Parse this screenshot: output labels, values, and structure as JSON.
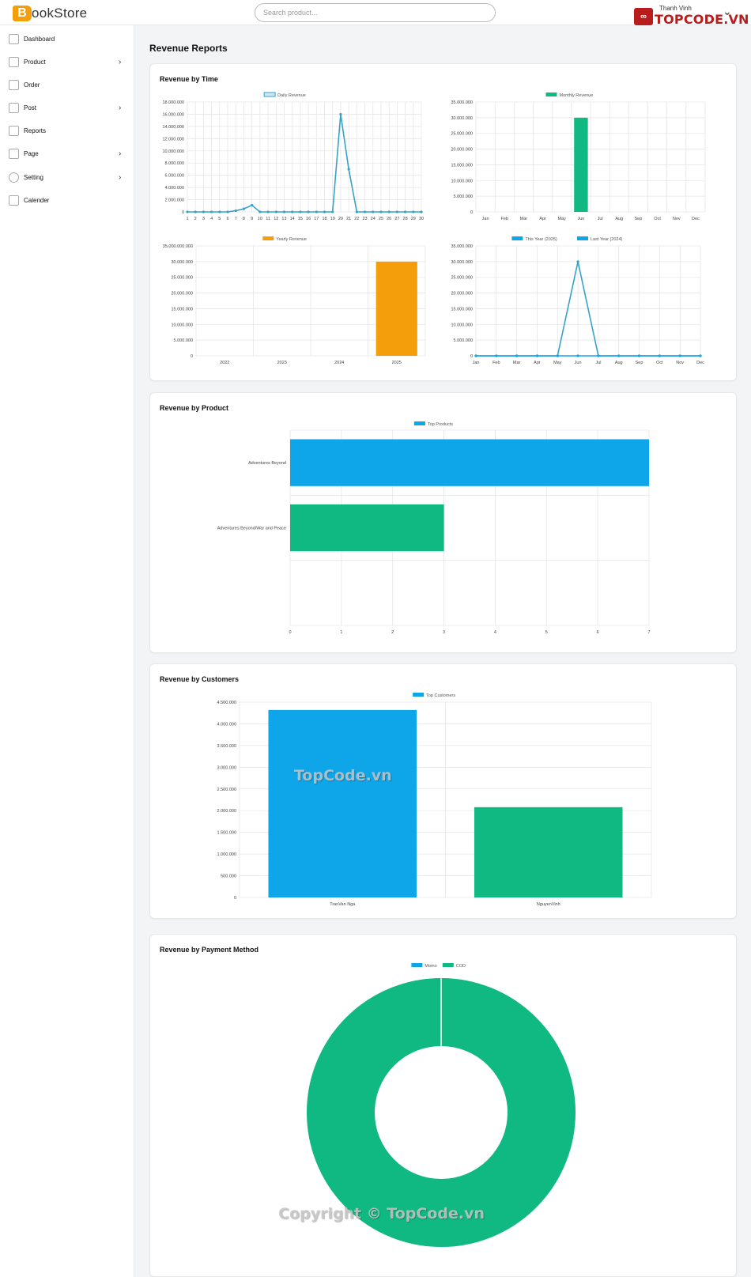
{
  "app": {
    "logo_letter": "B",
    "logo_text": "ookStore"
  },
  "search": {
    "placeholder": "Search product..."
  },
  "brand": {
    "user_name": "Thanh Vinh",
    "name": "TOPCODE.VN"
  },
  "sidebar": {
    "items": [
      {
        "label": "Dashboard",
        "icon": "home-icon",
        "has_submenu": false
      },
      {
        "label": "Product",
        "icon": "box-icon",
        "has_submenu": true
      },
      {
        "label": "Order",
        "icon": "clipboard-icon",
        "has_submenu": false
      },
      {
        "label": "Post",
        "icon": "note-icon",
        "has_submenu": true
      },
      {
        "label": "Reports",
        "icon": "chart-icon",
        "has_submenu": false
      },
      {
        "label": "Page",
        "icon": "page-icon",
        "has_submenu": true
      },
      {
        "label": "Setting",
        "icon": "gear-icon",
        "has_submenu": true
      },
      {
        "label": "Calender",
        "icon": "calendar-icon",
        "has_submenu": false
      }
    ]
  },
  "page": {
    "title": "Revenue Reports"
  },
  "sections": {
    "time": "Revenue by Time",
    "product": "Revenue by Product",
    "customers": "Revenue by Customers",
    "payment": "Revenue by Payment Method"
  },
  "colors": {
    "blue": "#0ea5e9",
    "line": "#36a2c8",
    "green": "#10b981",
    "orange": "#f59e0b"
  },
  "chart_data": [
    {
      "id": "daily",
      "type": "line",
      "legend": [
        "Daily Revenue"
      ],
      "x": [
        "1",
        "2",
        "3",
        "4",
        "5",
        "6",
        "7",
        "8",
        "9",
        "10",
        "11",
        "12",
        "13",
        "14",
        "15",
        "16",
        "17",
        "18",
        "19",
        "20",
        "21",
        "22",
        "23",
        "24",
        "25",
        "26",
        "27",
        "28",
        "29",
        "30"
      ],
      "series": [
        {
          "name": "Daily Revenue",
          "values": [
            0,
            0,
            0,
            0,
            0,
            0,
            200000,
            500000,
            1100000,
            0,
            0,
            0,
            0,
            0,
            0,
            0,
            0,
            0,
            0,
            16000000,
            7000000,
            0,
            0,
            0,
            0,
            0,
            0,
            0,
            0,
            0
          ]
        }
      ],
      "ylim": [
        0,
        18000000
      ],
      "yticks": [
        "0",
        "2.000.000",
        "4.000.000",
        "6.000.000",
        "8.000.000",
        "10.000.000",
        "12.000.000",
        "14.000.000",
        "16.000.000",
        "18.000.000"
      ]
    },
    {
      "id": "monthly",
      "type": "bar",
      "legend": [
        "Monthly Revenue"
      ],
      "categories": [
        "Jan",
        "Feb",
        "Mar",
        "Apr",
        "May",
        "Jun",
        "Jul",
        "Aug",
        "Sep",
        "Oct",
        "Nov",
        "Dec"
      ],
      "values": [
        0,
        0,
        0,
        0,
        0,
        30000000,
        0,
        0,
        0,
        0,
        0,
        0
      ],
      "ylim": [
        0,
        35000000
      ],
      "yticks": [
        "0",
        "5.000.000",
        "10.000.000",
        "15.000.000",
        "20.000.000",
        "25.000.000",
        "30.000.000",
        "35.000.000"
      ]
    },
    {
      "id": "yearly",
      "type": "bar",
      "legend": [
        "Yearly Revenue"
      ],
      "categories": [
        "2022",
        "2023",
        "2024",
        "2025"
      ],
      "values": [
        0,
        0,
        0,
        30000000
      ],
      "ylim": [
        0,
        35000000
      ],
      "yticks": [
        "0",
        "5.000.000",
        "10.000.000",
        "15.000.000",
        "20.000.000",
        "25.000.000",
        "30.000.000",
        "35.000.000.000"
      ]
    },
    {
      "id": "compare",
      "type": "line",
      "legend": [
        "This Year (2025)",
        "Last Year (2024)"
      ],
      "categories": [
        "Jan",
        "Feb",
        "Mar",
        "Apr",
        "May",
        "Jun",
        "Jul",
        "Aug",
        "Sep",
        "Oct",
        "Nov",
        "Dec"
      ],
      "series": [
        {
          "name": "This Year (2025)",
          "values": [
            0,
            0,
            0,
            0,
            0,
            30000000,
            0,
            0,
            0,
            0,
            0,
            0
          ]
        },
        {
          "name": "Last Year (2024)",
          "values": [
            0,
            0,
            0,
            0,
            0,
            0,
            0,
            0,
            0,
            0,
            0,
            0
          ]
        }
      ],
      "ylim": [
        0,
        35000000
      ],
      "yticks": [
        "0",
        "5.000.000",
        "10.000.000",
        "15.000.000",
        "20.000.000",
        "25.000.000",
        "30.000.000",
        "35.000.000"
      ]
    },
    {
      "id": "products",
      "type": "bar",
      "orientation": "horizontal",
      "legend": [
        "Top Products"
      ],
      "categories": [
        "Adventures Beyond",
        "Adventures Beyond/War and Peace"
      ],
      "values": [
        7,
        3
      ],
      "xlim": [
        0,
        7
      ],
      "xticks": [
        "0",
        "1",
        "2",
        "3",
        "4",
        "5",
        "6",
        "7"
      ]
    },
    {
      "id": "customers",
      "type": "bar",
      "legend": [
        "Top Customers"
      ],
      "categories": [
        "TranVan Nga",
        "NguyenVinh"
      ],
      "values": [
        4320000,
        2080000
      ],
      "ylim": [
        0,
        4500000
      ],
      "yticks": [
        "0",
        "500.000",
        "1.000.000",
        "1.500.000",
        "2.000.000",
        "2.500.000",
        "3.000.000",
        "3.500.000",
        "4.000.000",
        "4.500.000"
      ]
    },
    {
      "id": "payment",
      "type": "pie",
      "legend": [
        "Momo",
        "COD"
      ],
      "values": [
        0,
        100
      ]
    }
  ],
  "watermarks": {
    "center": "TopCode.vn",
    "bottom": "Copyright © TopCode.vn"
  }
}
